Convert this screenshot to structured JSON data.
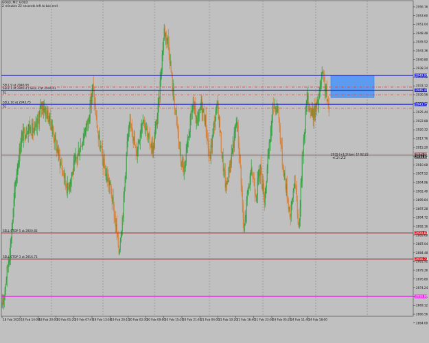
{
  "header": {
    "symbol_line": "GOLD, M1: GOLD",
    "countdown_line": "2 minutes 22 seconds left to bar end"
  },
  "colors": {
    "background": "#c0c0c0",
    "bull": "#1a9e2e",
    "bear": "#e0761e",
    "level_blue": "#1f22d6",
    "level_red": "#e0141e",
    "level_magenta": "#ee1cee",
    "dashdot_red": "#d94a4a",
    "zone_blue": "#5b9bf0",
    "bid_line": "#c25a5a",
    "grid": "#7a7a7a"
  },
  "chart_data": {
    "type": "candlestick",
    "symbol": "GOLD",
    "timeframe": "M1",
    "ylim": [
      2906.5,
      2962.2
    ],
    "grid": "vertical dashed",
    "y_ticks": [
      "2956.16",
      "2953.60",
      "2951.04",
      "2948.48",
      "2945.92",
      "2943.36",
      "2940.80",
      "2938.24",
      "2935.68",
      "2933.12",
      "2930.56",
      "2928.00",
      "2925.44",
      "2922.88",
      "2920.32",
      "2917.76",
      "2915.20",
      "2912.64",
      "2910.08",
      "2907.52",
      "2904.96",
      "2902.40",
      "2899.84",
      "2897.28",
      "2894.72",
      "2892.16",
      "2889.60",
      "2887.04",
      "2884.48",
      "2881.92",
      "2879.36",
      "2876.80",
      "2874.24",
      "2871.68",
      "2869.12",
      "2866.56",
      "2864.00"
    ],
    "x_ticks": [
      "18 Feb 2025",
      "18 Feb 14:08",
      "18 Feb 20:00",
      "19 Feb 01:20",
      "19 Feb 07:40",
      "19 Feb 13:58",
      "19 Feb 20:10",
      "20 Feb 02:30",
      "20 Feb 09:00",
      "20 Feb 15:20",
      "20 Feb 21:40",
      "21 Feb 04:00",
      "21 Feb 10:20",
      "21 Feb 16:40",
      "21 Feb 23:00",
      "24 Feb 05:20",
      "24 Feb 11:40",
      "24 Feb 18:00"
    ],
    "anchors": [
      [
        0,
        2908
      ],
      [
        12,
        2919
      ],
      [
        20,
        2931
      ],
      [
        28,
        2938
      ],
      [
        38,
        2940
      ],
      [
        48,
        2939
      ],
      [
        58,
        2944
      ],
      [
        70,
        2941
      ],
      [
        82,
        2935
      ],
      [
        95,
        2929
      ],
      [
        110,
        2935
      ],
      [
        125,
        2941
      ],
      [
        132,
        2947
      ],
      [
        140,
        2938
      ],
      [
        150,
        2932
      ],
      [
        158,
        2929
      ],
      [
        165,
        2923
      ],
      [
        170,
        2918
      ],
      [
        176,
        2925
      ],
      [
        182,
        2937
      ],
      [
        188,
        2941
      ],
      [
        195,
        2935
      ],
      [
        205,
        2942
      ],
      [
        212,
        2938
      ],
      [
        220,
        2936
      ],
      [
        228,
        2944
      ],
      [
        232,
        2951
      ],
      [
        236,
        2957
      ],
      [
        242,
        2955
      ],
      [
        248,
        2947
      ],
      [
        254,
        2941
      ],
      [
        260,
        2934
      ],
      [
        266,
        2932
      ],
      [
        272,
        2939
      ],
      [
        278,
        2944
      ],
      [
        284,
        2940
      ],
      [
        290,
        2944
      ],
      [
        296,
        2941
      ],
      [
        302,
        2934
      ],
      [
        308,
        2940
      ],
      [
        314,
        2944
      ],
      [
        320,
        2935
      ],
      [
        326,
        2929
      ],
      [
        334,
        2935
      ],
      [
        342,
        2941
      ],
      [
        348,
        2931
      ],
      [
        352,
        2921
      ],
      [
        358,
        2929
      ],
      [
        364,
        2932
      ],
      [
        370,
        2928
      ],
      [
        376,
        2933
      ],
      [
        382,
        2927
      ],
      [
        388,
        2935
      ],
      [
        395,
        2944
      ],
      [
        402,
        2943
      ],
      [
        408,
        2934
      ],
      [
        414,
        2929
      ],
      [
        420,
        2924
      ],
      [
        426,
        2931
      ],
      [
        432,
        2922
      ],
      [
        438,
        2936
      ],
      [
        444,
        2945
      ],
      [
        452,
        2942
      ],
      [
        460,
        2944
      ],
      [
        466,
        2949
      ],
      [
        472,
        2946
      ],
      [
        476,
        2942
      ]
    ],
    "bid_price": "2935.06",
    "ask_price": "2934.85",
    "countdown": "<2:22",
    "bid_tag_label": "2935 [+1:5] bar: 1? 02:22"
  },
  "levels": [
    {
      "id": "sell_tp",
      "price": 2949,
      "label": "",
      "tag": "2949.00",
      "color": "#1f22d6",
      "style": "solid",
      "width": 1.3
    },
    {
      "id": "sell_entry",
      "price": 2946.4,
      "label": "SELL 1 at 2946.4 / SELL 1 at 2946.41",
      "tag": "2946.40",
      "color": "#1f22d6",
      "style": "solid",
      "width": 1.3
    },
    {
      "id": "sell9",
      "price": 2946.95,
      "label": "SELL 9 at 2946.95",
      "tag": "",
      "color": "#d94a4a",
      "style": "dashdot",
      "width": 0.8
    },
    {
      "id": "sl_upper",
      "price": 2945.6,
      "label": "SL",
      "tag": "",
      "color": "#d94a4a",
      "style": "dashdot",
      "width": 0.8
    },
    {
      "id": "sell10",
      "price": 2943.9,
      "label": "SELL 10 at 2943.75",
      "tag": "2943.75",
      "color": "#1f22d6",
      "style": "solid",
      "width": 1.3
    },
    {
      "id": "sl_lower",
      "price": 2943.2,
      "label": "SL",
      "tag": "",
      "color": "#d94a4a",
      "style": "dashdot",
      "width": 0.8
    },
    {
      "id": "sell_stop_5",
      "price": 2921.2,
      "label": "SELL STOP 5 at 2920.83",
      "tag": "2920.83",
      "color": "#e0141e",
      "style": "solid",
      "width": 1.3
    },
    {
      "id": "sell_stop_3",
      "price": 2916.6,
      "label": "SELL STOP 3 at 2916.73",
      "tag": "2916.73",
      "color": "#e0141e",
      "style": "solid",
      "width": 1.3
    },
    {
      "id": "magenta",
      "price": 2910.0,
      "label": "",
      "tag": "2910.08",
      "color": "#ee1cee",
      "style": "solid",
      "width": 1.3
    }
  ]
}
